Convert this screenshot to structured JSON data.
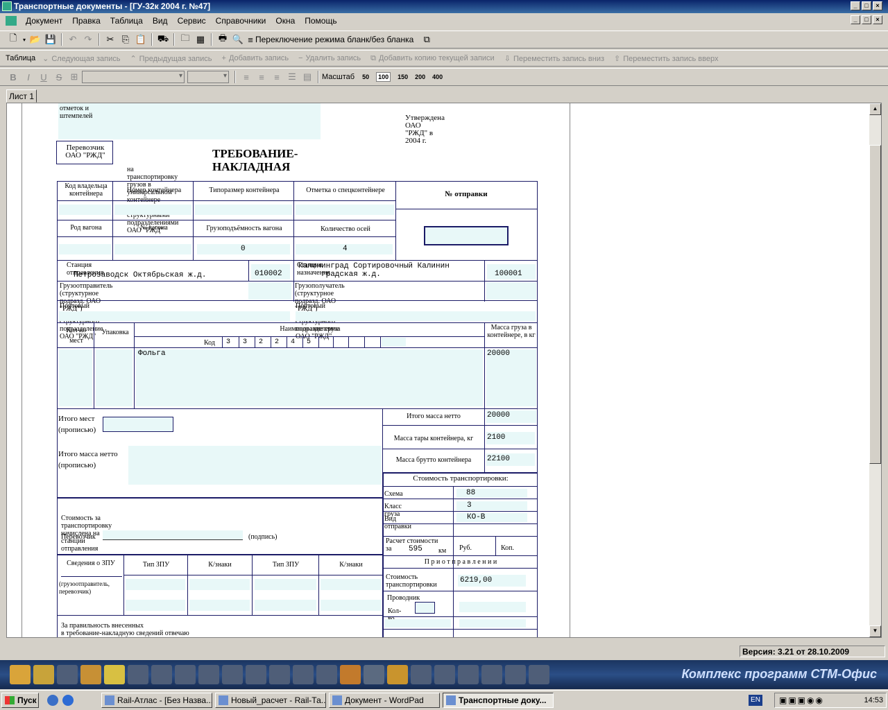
{
  "window": {
    "title": "Транспортные документы - [ГУ-32к 2004 г. №47]"
  },
  "menu": [
    "Документ",
    "Правка",
    "Таблица",
    "Вид",
    "Сервис",
    "Справочники",
    "Окна",
    "Помощь"
  ],
  "toolbar1": {
    "mode_label": "Переключение режима бланк/без бланка"
  },
  "toolbar2": {
    "table_label": "Таблица",
    "items": [
      "Следующая запись",
      "Предыдущая запись",
      "Добавить запись",
      "Удалить запись",
      "Добавить копию текущей записи",
      "Переместить запись вниз",
      "Переместить запись вверх"
    ]
  },
  "toolbar3": {
    "scale_label": "Масштаб",
    "zooms": [
      "50",
      "100",
      "150",
      "200",
      "400"
    ],
    "zoom_selected": "100"
  },
  "sheet_tab": "Лист 1",
  "form": {
    "stamp_text": "отметок и штемпелей",
    "approved": "Утверждена ОАО \"РЖД\" в 2004 г.",
    "carrier_box": "Перевозчик ОАО \"РЖД\"",
    "title": "ТРЕБОВАНИЕ-НАКЛАДНАЯ",
    "subtitle": "на транспортировку грузов в универсальном контейнере между структурными подразделениями ОАО \"РЖД\"",
    "col_owner": "Код владельца контейнера",
    "col_container_no": "Номер контейнера",
    "col_size": "Типоразмер контейнера",
    "col_special": "Отметка о спецконтейнере",
    "dispatch_no": "№ отправки",
    "col_wagon_type": "Род вагона",
    "col_wagon_no": "№ вагона",
    "col_capacity": "Грузоподъёмность вагона",
    "col_axles": "Количество осей",
    "capacity_value": "0",
    "axles_value": "4",
    "dep_station_label": "Станция отправления",
    "dep_station_value": "Петрозаводск Октябрьская ж.д.",
    "dep_code": "010002",
    "dest_station_label": "Станция назначения",
    "dest_station_value": "Калининград Сортировочный Калинин\n     градская ж.д.",
    "dest_code": "100001",
    "shipper_label": "Грузоотправитель (структурное подразд. ОАО \"РЖД\")",
    "consignee_label": "Грузополучатель  (структурное подразд. ОАО \"РЖД\")",
    "postal_shipper": "Почтовый адрес структурного подразделение ОАО \"РЖД\"",
    "postal_consignee": "Почтовый адрес структурного подразделение ОАО \"РЖД\"",
    "col_places": "Кол-во мест",
    "col_pack": "Упаковка",
    "col_cargo_name": "Наименование груза",
    "col_code_label": "Код",
    "code_digits": [
      "3",
      "3",
      "2",
      "2",
      "4",
      "5"
    ],
    "col_mass": "Масса груза в контейнере, в кг",
    "cargo_name": "Фольга",
    "cargo_mass": "20000",
    "total_places_label": "Итого мест\n(прописью)",
    "total_net_words_label": "Итого масса нетто\n(прописью)",
    "total_net_label": "Итого масса нетто",
    "total_net_value": "20000",
    "tare_label": "Масса тары контейнера, кг",
    "tare_value": "2100",
    "gross_label": "Масса брутто контейнера",
    "gross_value": "22100",
    "cost_header": "Стоимость транспортировки:",
    "scheme_label": "Схема",
    "scheme_value": "88",
    "class_label": "Класс груза",
    "class_value": "3",
    "kind_label": "Вид отправки",
    "kind_value": "КО-В",
    "calc_label": "Расчет стоимости\nза",
    "calc_km": "595",
    "km_label": "км",
    "rub_label": "Руб.",
    "kop_label": "Коп.",
    "on_dispatch": "П р и   о т п р а в л е н и и",
    "cost_transport_label": "Стоимость\nтранспортировки",
    "cost_transport_value": "6219,00",
    "escort_label": "Проводник",
    "escort_count_label": "Кол-во",
    "cost_charged": "Стоимость за транспортировку начислена на станции отправления",
    "carrier_sign_label": "Перевозчик",
    "sign_label": "(подпись)",
    "zpu_info": "Сведения о ЗПУ",
    "zpu_who": "(грузоотправитель,\nперевозчик)",
    "zpu_type1": "Тип ЗПУ",
    "zpu_marks1": "К/знаки",
    "zpu_type2": "Тип ЗПУ",
    "zpu_marks2": "К/знаки",
    "responsible": "За правильность внесенных\nв требование-накладную сведений отвечаю"
  },
  "status": {
    "version": "Версия: 3.21 от 28.10.2009"
  },
  "appbar": {
    "brand": "Комплекс программ СТМ-Офис"
  },
  "taskbar": {
    "start": "Пуск",
    "tasks": [
      "Rail-Атлас - [Без Назва...",
      "Новый_расчет - Rail-Та...",
      "Документ - WordPad",
      "Транспортные доку..."
    ],
    "lang": "EN",
    "clock": "14:53"
  }
}
